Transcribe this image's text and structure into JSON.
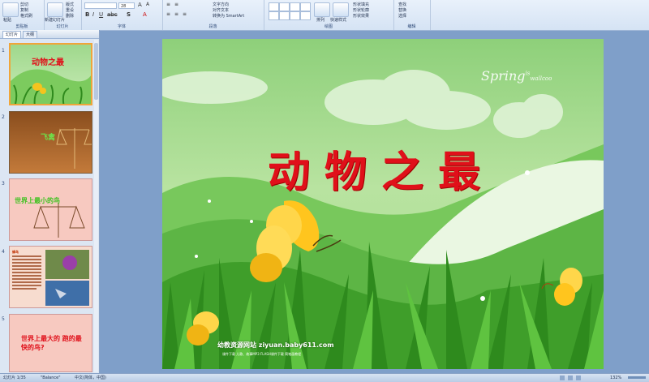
{
  "ribbon": {
    "clipboard": {
      "paste": "粘贴",
      "cut": "剪切",
      "copy": "复制",
      "format_painter": "格式刷",
      "label": "剪贴板"
    },
    "slides": {
      "new_slide": "新建幻灯片",
      "layout": "版式",
      "reset": "重设",
      "delete": "删除",
      "label": "幻灯片"
    },
    "font": {
      "font_size": "28",
      "label": "字体"
    },
    "paragraph": {
      "text_direction": "文字方向",
      "align_text": "对齐文本",
      "smartart": "转换为 SmartArt",
      "label": "段落"
    },
    "drawing": {
      "arrange": "排列",
      "quick_styles": "快速样式",
      "shape_fill": "形状填充",
      "shape_outline": "形状轮廓",
      "shape_effects": "形状效果",
      "label": "绘图"
    },
    "editing": {
      "find": "查找",
      "replace": "替换",
      "select": "选择",
      "label": "编辑"
    }
  },
  "panel": {
    "tabs": [
      "幻灯片",
      "大纲"
    ],
    "slides": [
      {
        "num": "1",
        "title": "动物之最"
      },
      {
        "num": "2",
        "title": "飞禽"
      },
      {
        "num": "3",
        "title": "世界上最小的鸟"
      },
      {
        "num": "4",
        "title": "蜂鸟"
      },
      {
        "num": "5",
        "title": "世界上最大的 跑的最快的鸟?"
      }
    ]
  },
  "slide": {
    "title": "动物之最",
    "logo_main": "Spring",
    "logo_sup": "is",
    "logo_sub": "wallcoo",
    "watermark": "幼教资源网站  ziyuan.baby611.com",
    "watermark_sub": "课件下载   儿歌、故事MP3   FLASH课件下载   简笔画教程"
  },
  "status": {
    "slide_info": "幻灯片 1/35",
    "theme": "\"Balance\"",
    "language": "中文(简体，中国)",
    "zoom": "132%"
  },
  "colors": {
    "title_red": "#e0101a",
    "ribbon_bg": "#dbe7f5",
    "workspace": "#7f9fc9",
    "grass": "#3f9e2a"
  }
}
